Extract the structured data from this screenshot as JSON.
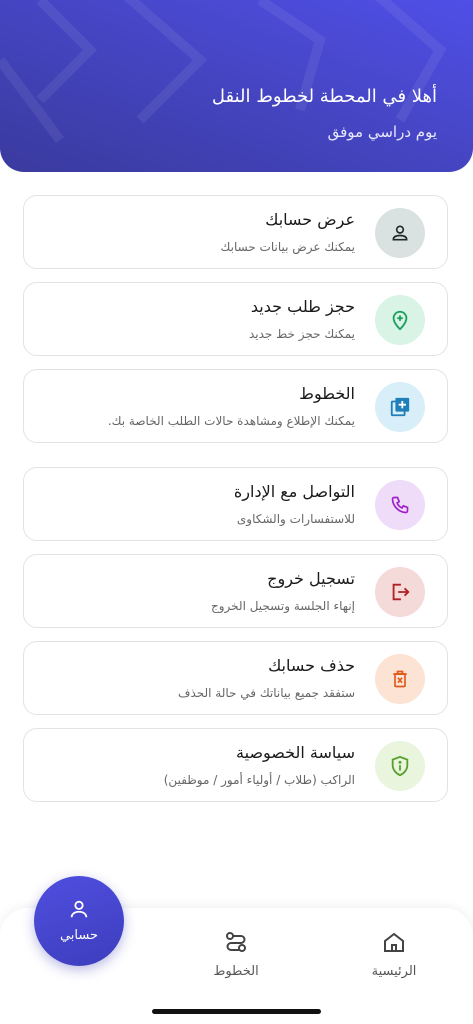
{
  "header": {
    "title": "أهلا في المحطة لخطوط النقل",
    "subtitle": "يوم دراسي موفق"
  },
  "menu": [
    {
      "title": "عرض حسابك",
      "subtitle": "يمكنك عرض بيانات حسابك",
      "icon": "user-icon",
      "color": "#1f2a2a",
      "bg": "#d9e2e0"
    },
    {
      "title": "حجز طلب جديد",
      "subtitle": "يمكنك حجز خط جديد",
      "icon": "location-plus-icon",
      "color": "#1aa05a",
      "bg": "#d9f3e6"
    },
    {
      "title": "الخطوط",
      "subtitle": "يمكنك الإطلاع ومشاهدة حالات الطلب الخاصة بك.",
      "icon": "add-box-icon",
      "color": "#1f7fb8",
      "bg": "#d8eef9"
    },
    {
      "title": "التواصل مع الإدارة",
      "subtitle": "للاستفسارات والشكاوى",
      "icon": "phone-icon",
      "color": "#a020c8",
      "bg": "#efdcf8"
    },
    {
      "title": "تسجيل خروج",
      "subtitle": "إنهاء الجلسة وتسجيل الخروج",
      "icon": "logout-icon",
      "color": "#b02020",
      "bg": "#f5dada"
    },
    {
      "title": "حذف حسابك",
      "subtitle": "ستفقد جميع بياناتك في حالة الحذف",
      "icon": "delete-icon",
      "color": "#e05a1a",
      "bg": "#fde3d4"
    },
    {
      "title": "سياسة الخصوصية",
      "subtitle": "الراكب (طلاب / أولياء أمور / موظفين)",
      "icon": "shield-info-icon",
      "color": "#5aa030",
      "bg": "#e9f5dc"
    }
  ],
  "nav": {
    "home_label": "الرئيسية",
    "lines_label": "الخطوط",
    "account_label": "حسابي"
  }
}
